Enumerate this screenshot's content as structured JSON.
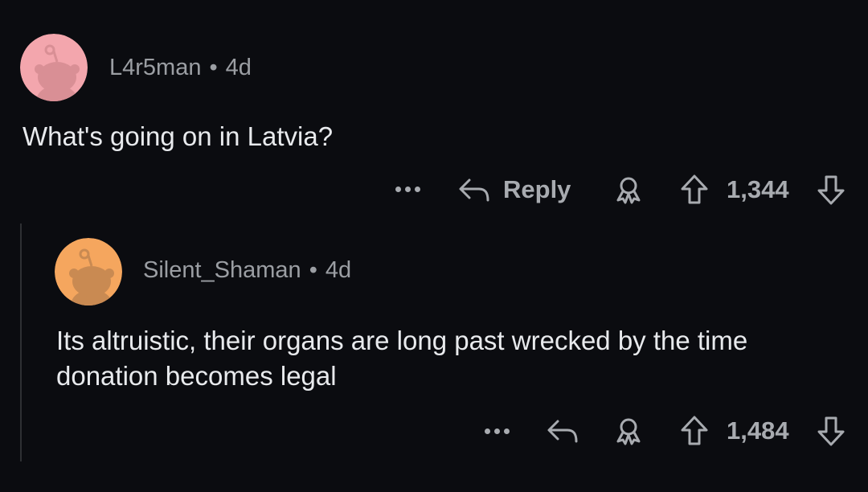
{
  "comments": [
    {
      "username": "L4r5man",
      "separator": "•",
      "age": "4d",
      "text": "What's going on in Latvia?",
      "reply_label": "Reply",
      "score": "1,344",
      "avatar_color": "#f3a6ad"
    },
    {
      "username": "Silent_Shaman",
      "separator": "•",
      "age": "4d",
      "text": "Its altruistic, their organs are long past wrecked by the time donation becomes legal",
      "score": "1,484",
      "avatar_color": "#f5a65e"
    }
  ],
  "colors": {
    "background": "#0b0c10",
    "text": "#e8eaed",
    "muted": "#9b9ea3"
  }
}
